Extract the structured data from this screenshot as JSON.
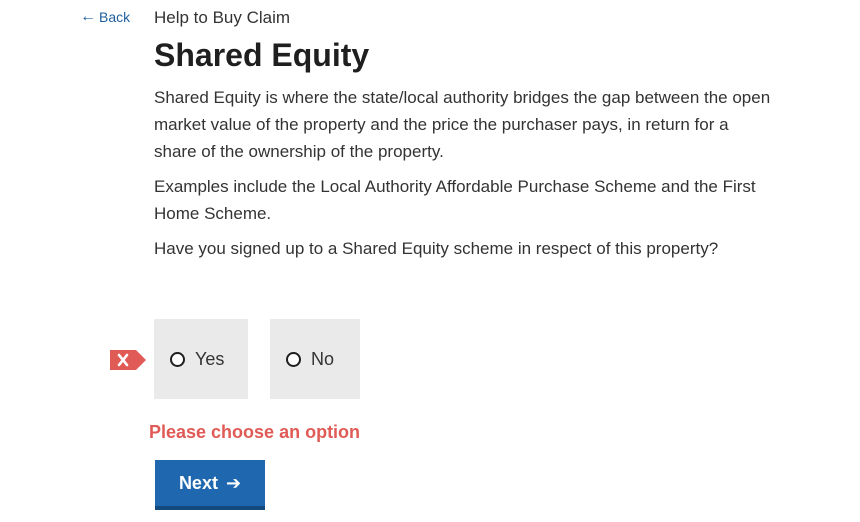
{
  "nav": {
    "back_icon": "arrow-left-icon",
    "back_label": "Back"
  },
  "header": {
    "section_label": "Help to Buy Claim",
    "title": "Shared Equity"
  },
  "body": {
    "paragraph_1": "Shared Equity is where the state/local authority bridges the gap between the open market value of the property and the price the purchaser pays, in return for a share of the ownership of the property.",
    "paragraph_2": "Examples include the Local Authority Affordable Purchase Scheme and the First Home Scheme.",
    "question": "Have you signed up to a Shared Equity scheme in respect of this property?"
  },
  "options": [
    {
      "label": "Yes",
      "selected": false
    },
    {
      "label": "No",
      "selected": false
    }
  ],
  "error": {
    "icon": "error-x-icon",
    "message": "Please choose an option",
    "color": "#e05b55"
  },
  "next_button": {
    "label": "Next",
    "icon": "arrow-right-icon",
    "color": "#1f68b0"
  }
}
